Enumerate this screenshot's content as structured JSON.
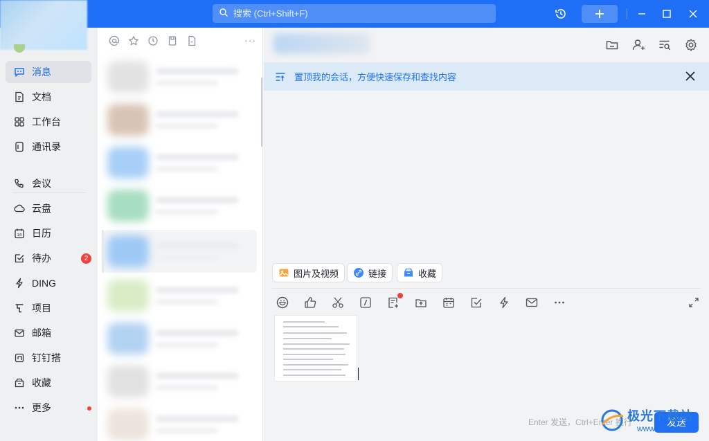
{
  "titlebar": {
    "search_placeholder": "搜索 (Ctrl+Shift+F)"
  },
  "leftnav": {
    "items": [
      {
        "label": "消息",
        "icon": "chat-bubble-icon",
        "active": true
      },
      {
        "label": "文档",
        "icon": "document-icon"
      },
      {
        "label": "工作台",
        "icon": "grid-apps-icon"
      },
      {
        "label": "通讯录",
        "icon": "contacts-book-icon"
      },
      {
        "label": "会议",
        "icon": "phone-meeting-icon"
      },
      {
        "label": "云盘",
        "icon": "cloud-icon"
      },
      {
        "label": "日历",
        "icon": "calendar-icon"
      },
      {
        "label": "待办",
        "icon": "todo-check-icon",
        "badge": "2"
      },
      {
        "label": "DING",
        "icon": "lightning-icon"
      },
      {
        "label": "项目",
        "icon": "project-icon"
      },
      {
        "label": "邮箱",
        "icon": "mail-icon"
      },
      {
        "label": "钉钉搭",
        "icon": "build-block-icon"
      },
      {
        "label": "收藏",
        "icon": "favorites-box-icon"
      },
      {
        "label": "更多",
        "icon": "more-dots-icon",
        "dot": true
      }
    ]
  },
  "convlist": {
    "filter_icons": [
      "at-mention-icon",
      "star-icon",
      "clock-icon",
      "bookmark-icon",
      "file-icon"
    ],
    "more_label": "···"
  },
  "chat": {
    "banner_text": "置顶我的会话，方便快速保存和查找内容",
    "quick_actions": [
      {
        "label": "图片及视频",
        "icon": "image-icon"
      },
      {
        "label": "链接",
        "icon": "link-icon"
      },
      {
        "label": "收藏",
        "icon": "favorites-box-icon"
      }
    ],
    "toolbar_icons": [
      "emoji-icon",
      "thumbs-up-icon",
      "scissors-icon",
      "slash-command-icon",
      "note-add-icon",
      "upload-icon",
      "calendar-icon",
      "task-check-icon",
      "ding-lightning-icon",
      "mail-icon",
      "more-dots-icon"
    ],
    "hint": "Enter 发送，Ctrl+Enter 换行",
    "send_label": "发送"
  },
  "watermark": {
    "text": "极光下载站",
    "url": "www.xz7.com"
  },
  "colors": {
    "brand_blue": "#1e6ff5",
    "badge_red": "#f2403c",
    "banner_bg": "#dceaf8"
  }
}
